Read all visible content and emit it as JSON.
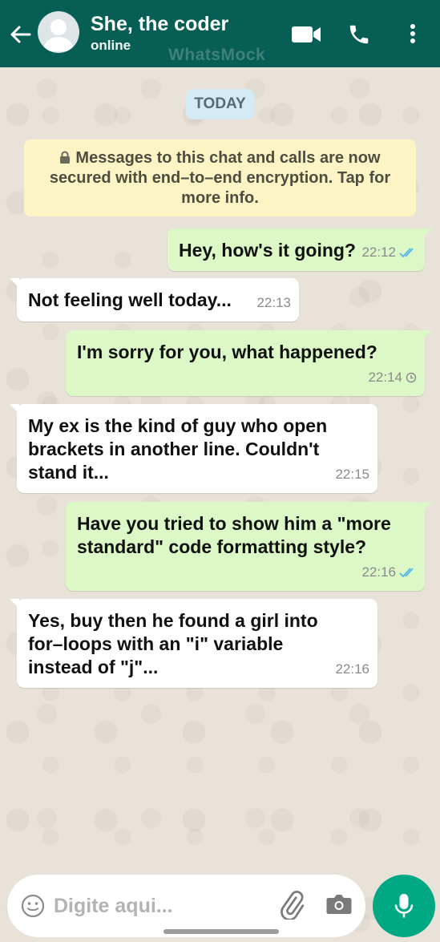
{
  "header": {
    "contact_name": "She, the coder",
    "status": "online",
    "watermark": "WhatsMock"
  },
  "date_chip": "TODAY",
  "encryption_notice": "Messages to this chat and calls are now secured with end–to–end encryption. Tap for more info.",
  "messages": [
    {
      "direction": "out",
      "text": "Hey, how's it going?",
      "time": "22:12",
      "status": "read"
    },
    {
      "direction": "in",
      "text": "Not feeling well today...",
      "time": "22:13"
    },
    {
      "direction": "out",
      "text": "I'm sorry for you, what happened?",
      "time": "22:14",
      "status": "pending"
    },
    {
      "direction": "in",
      "text": "My ex is the kind of guy who open brackets in another line. Couldn't stand it...",
      "time": "22:15"
    },
    {
      "direction": "out",
      "text": "Have you tried to show him a \"more standard\" code formatting style?",
      "time": "22:16",
      "status": "read"
    },
    {
      "direction": "in",
      "text": "Yes, buy then he found a girl into for–loops with an \"i\" variable instead of \"j\"...",
      "time": "22:16"
    }
  ],
  "composer": {
    "placeholder": "Digite aqui..."
  },
  "colors": {
    "header": "#075e54",
    "outgoing_bubble": "#dcf8c6",
    "incoming_bubble": "#ffffff",
    "read_ticks": "#4fb6ec",
    "mic_button": "#00a884"
  }
}
